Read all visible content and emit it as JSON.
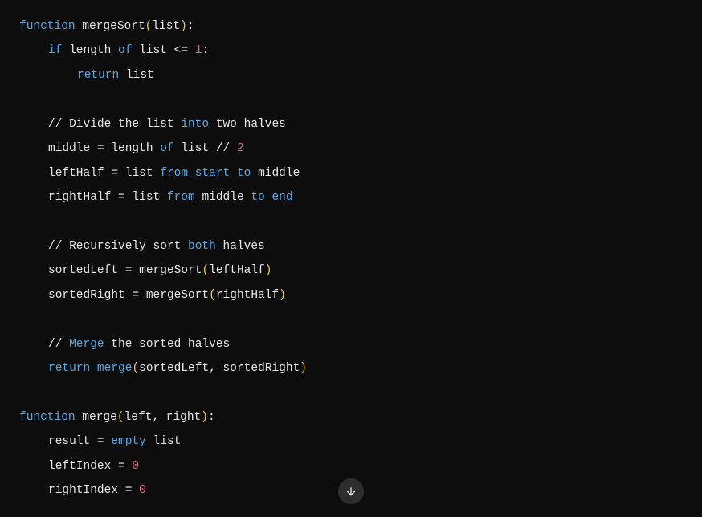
{
  "code": {
    "lines": [
      {
        "indent": 0,
        "tokens": [
          {
            "text": "function",
            "cls": "kw-function"
          },
          {
            "text": " ",
            "cls": ""
          },
          {
            "text": "mergeSort",
            "cls": "fn-name"
          },
          {
            "text": "(",
            "cls": "paren"
          },
          {
            "text": "list",
            "cls": "param"
          },
          {
            "text": ")",
            "cls": "paren"
          },
          {
            "text": ":",
            "cls": "op"
          }
        ]
      },
      {
        "indent": 1,
        "tokens": [
          {
            "text": "if",
            "cls": "kw-control"
          },
          {
            "text": " length ",
            "cls": "ident"
          },
          {
            "text": "of",
            "cls": "kw-misc"
          },
          {
            "text": " list <= ",
            "cls": "ident"
          },
          {
            "text": "1",
            "cls": "num"
          },
          {
            "text": ":",
            "cls": "op"
          }
        ]
      },
      {
        "indent": 2,
        "tokens": [
          {
            "text": "return",
            "cls": "kw-return"
          },
          {
            "text": " list",
            "cls": "ident"
          }
        ]
      },
      {
        "indent": 0,
        "tokens": []
      },
      {
        "indent": 1,
        "tokens": [
          {
            "text": "// Divide the list ",
            "cls": "comment"
          },
          {
            "text": "into",
            "cls": "kw-misc"
          },
          {
            "text": " two halves",
            "cls": "comment"
          }
        ]
      },
      {
        "indent": 1,
        "tokens": [
          {
            "text": "middle = length ",
            "cls": "ident"
          },
          {
            "text": "of",
            "cls": "kw-misc"
          },
          {
            "text": " list // ",
            "cls": "ident"
          },
          {
            "text": "2",
            "cls": "num"
          }
        ]
      },
      {
        "indent": 1,
        "tokens": [
          {
            "text": "leftHalf = list ",
            "cls": "ident"
          },
          {
            "text": "from",
            "cls": "kw-misc"
          },
          {
            "text": " ",
            "cls": ""
          },
          {
            "text": "start",
            "cls": "kw-misc"
          },
          {
            "text": " ",
            "cls": ""
          },
          {
            "text": "to",
            "cls": "kw-misc"
          },
          {
            "text": " middle",
            "cls": "ident"
          }
        ]
      },
      {
        "indent": 1,
        "tokens": [
          {
            "text": "rightHalf = list ",
            "cls": "ident"
          },
          {
            "text": "from",
            "cls": "kw-misc"
          },
          {
            "text": " middle ",
            "cls": "ident"
          },
          {
            "text": "to",
            "cls": "kw-misc"
          },
          {
            "text": " ",
            "cls": ""
          },
          {
            "text": "end",
            "cls": "kw-misc"
          }
        ]
      },
      {
        "indent": 0,
        "tokens": []
      },
      {
        "indent": 1,
        "tokens": [
          {
            "text": "// Recursively sort ",
            "cls": "comment"
          },
          {
            "text": "both",
            "cls": "kw-misc"
          },
          {
            "text": " halves",
            "cls": "comment"
          }
        ]
      },
      {
        "indent": 1,
        "tokens": [
          {
            "text": "sortedLeft = mergeSort",
            "cls": "ident"
          },
          {
            "text": "(",
            "cls": "paren"
          },
          {
            "text": "leftHalf",
            "cls": "ident"
          },
          {
            "text": ")",
            "cls": "paren"
          }
        ]
      },
      {
        "indent": 1,
        "tokens": [
          {
            "text": "sortedRight = mergeSort",
            "cls": "ident"
          },
          {
            "text": "(",
            "cls": "paren"
          },
          {
            "text": "rightHalf",
            "cls": "ident"
          },
          {
            "text": ")",
            "cls": "paren"
          }
        ]
      },
      {
        "indent": 0,
        "tokens": []
      },
      {
        "indent": 1,
        "tokens": [
          {
            "text": "// ",
            "cls": "comment"
          },
          {
            "text": "Merge",
            "cls": "kw-misc"
          },
          {
            "text": " the sorted halves",
            "cls": "comment"
          }
        ]
      },
      {
        "indent": 1,
        "tokens": [
          {
            "text": "return",
            "cls": "kw-return"
          },
          {
            "text": " ",
            "cls": ""
          },
          {
            "text": "merge",
            "cls": "kw-misc"
          },
          {
            "text": "(",
            "cls": "paren"
          },
          {
            "text": "sortedLeft, sortedRight",
            "cls": "ident"
          },
          {
            "text": ")",
            "cls": "paren"
          }
        ]
      },
      {
        "indent": 0,
        "tokens": []
      },
      {
        "indent": 0,
        "tokens": [
          {
            "text": "function",
            "cls": "kw-function"
          },
          {
            "text": " ",
            "cls": ""
          },
          {
            "text": "merge",
            "cls": "fn-name"
          },
          {
            "text": "(",
            "cls": "paren"
          },
          {
            "text": "left, right",
            "cls": "param"
          },
          {
            "text": ")",
            "cls": "paren"
          },
          {
            "text": ":",
            "cls": "op"
          }
        ]
      },
      {
        "indent": 1,
        "tokens": [
          {
            "text": "result = ",
            "cls": "ident"
          },
          {
            "text": "empty",
            "cls": "kw-misc"
          },
          {
            "text": " list",
            "cls": "ident"
          }
        ]
      },
      {
        "indent": 1,
        "tokens": [
          {
            "text": "leftIndex = ",
            "cls": "ident"
          },
          {
            "text": "0",
            "cls": "num"
          }
        ]
      },
      {
        "indent": 1,
        "tokens": [
          {
            "text": "rightIndex = ",
            "cls": "ident"
          },
          {
            "text": "0",
            "cls": "num"
          }
        ]
      }
    ]
  }
}
